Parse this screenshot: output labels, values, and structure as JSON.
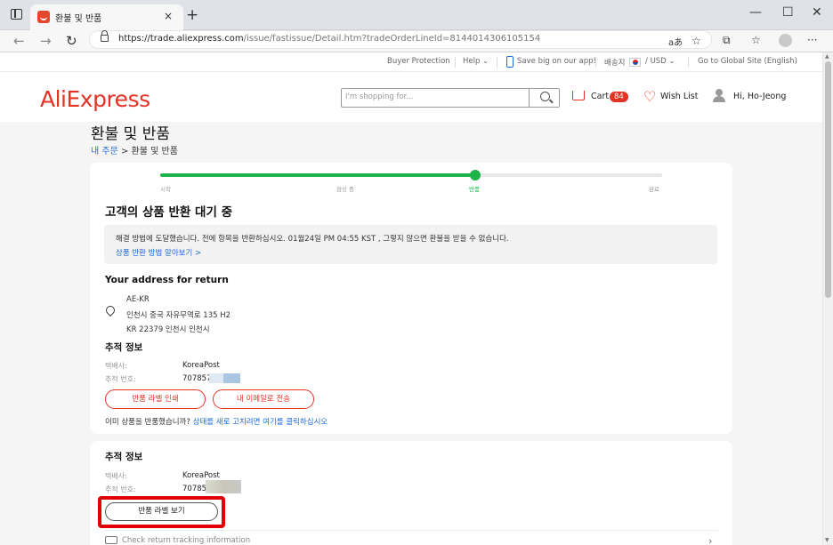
{
  "browser": {
    "tab_title": "환불 및 반품",
    "url_host": "https://trade.aliexpress.com",
    "url_path": "/issue/fastissue/Detail.htm?tradeOrderLineId=8144014306105154",
    "new_tab": "+",
    "close_tab": "×",
    "back": "←",
    "forward": "→",
    "reload": "↻",
    "read_aloud": "aあ",
    "favorite": "☆",
    "extensions": "⧉",
    "collections": "☆",
    "menu": "···",
    "minimize": "—",
    "maximize": "☐",
    "close_window": "✕"
  },
  "top_nav": {
    "buyer_protection": "Buyer Protection",
    "help": "Help ⌄",
    "app": "Save big on our app!",
    "ship_to": "배송지",
    "currency": "/ USD ⌄",
    "global_site": "Go to Global Site (English)"
  },
  "header": {
    "logo": "AliExpress",
    "search_placeholder": "I'm shopping for...",
    "cart_label": "Cart",
    "cart_count": "84",
    "wishlist_label": "Wish List",
    "greeting": "Hi, Ho-Jeong"
  },
  "page": {
    "title": "환불 및 반품",
    "breadcrumb_link": "내 주문",
    "breadcrumb_sep": " > ",
    "breadcrumb_current": "환불 및 반품"
  },
  "progress": {
    "fraction": 0.627,
    "steps": [
      "시작",
      "협상 중",
      "반품",
      "완료"
    ],
    "active_index": 2
  },
  "status": {
    "title": "고객의 상품 반환 대기 중",
    "info_text": "해결 방법에 도달했습니다. 전에 항목을 반환하십시오. 01월24일 PM 04:55 KST , 그렇지 않으면 환불을 받을 수 없습니다.",
    "info_link": "상품 반환 방법 알아보기 >"
  },
  "return_address": {
    "title": "Your address for return",
    "lines": [
      "AE-KR",
      "인천시 중국 자유무역로 135 H2",
      "KR 22379 인천시 인천시"
    ]
  },
  "tracking1": {
    "title": "추적 정보",
    "carrier_label": "택배사:",
    "carrier": "KoreaPost",
    "number_label": "추적 번호:",
    "number": "707857",
    "print_button": "반품 라벨 인쇄",
    "email_button": "내 이메일로 전송",
    "note": "이미 상품을 반품했습니까? ",
    "note_link": "상태를 새로 고치려면 여기를 클릭하십시오"
  },
  "tracking2": {
    "title": "추적 정보",
    "carrier_label": "택배사:",
    "carrier": "KoreaPost",
    "number_label": "추적 번호:",
    "number": "707857",
    "view_button": "반품 라벨 보기",
    "check_link": "Check return tracking information",
    "chevron": "›"
  },
  "colors": {
    "brand": "#e43225",
    "progress": "#1db34a",
    "link": "#1e6bd6",
    "highlight": "#e00000"
  }
}
